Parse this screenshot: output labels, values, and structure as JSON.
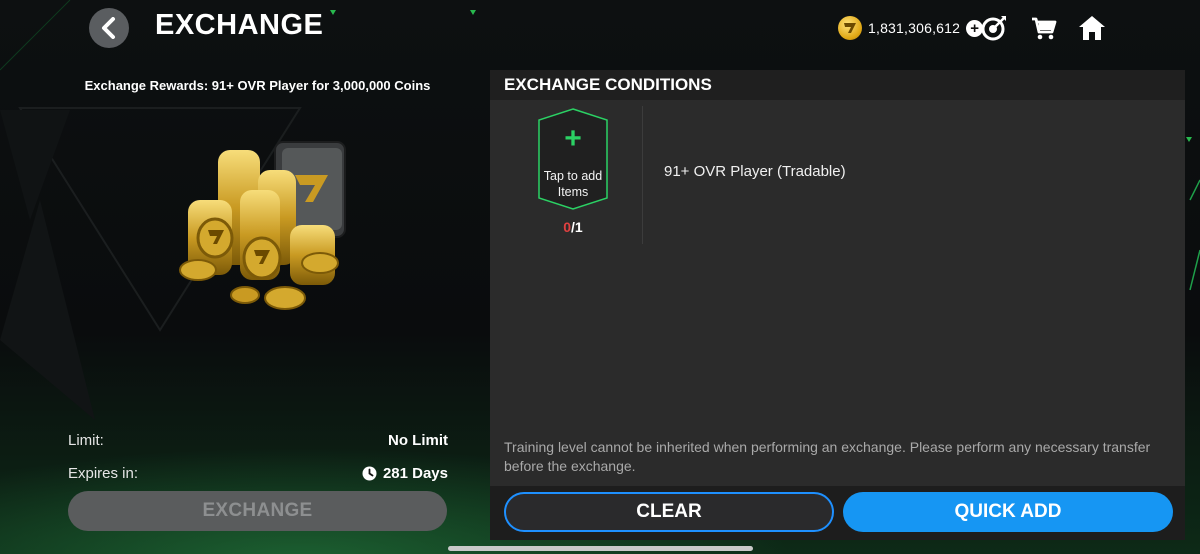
{
  "header": {
    "title": "EXCHANGE",
    "coin_balance": "1,831,306,612",
    "icons": [
      "back-arrow-icon",
      "coin-icon",
      "add-coins-icon",
      "target-icon",
      "cart-icon",
      "home-icon"
    ]
  },
  "left": {
    "rewards_text": "Exchange Rewards:  91+ OVR Player for 3,000,000 Coins",
    "limit_label": "Limit:",
    "limit_value": "No Limit",
    "expires_label": "Expires in:",
    "expires_value": "281 Days",
    "exchange_button": "EXCHANGE"
  },
  "panel": {
    "header": "EXCHANGE CONDITIONS",
    "slot_plus": "+",
    "slot_label": "Tap to add Items",
    "slot_count_current": "0",
    "slot_count_total": "/1",
    "condition": "91+ OVR Player (Tradable)",
    "note": "Training level cannot be inherited when performing an exchange. Please perform any necessary transfer before the exchange.",
    "clear_button": "CLEAR",
    "quick_add_button": "QUICK ADD"
  },
  "colors": {
    "accent_blue": "#1696f3",
    "slot_green": "#2bd164",
    "count_red": "#e04040",
    "coin_gold": "#e0a815"
  }
}
